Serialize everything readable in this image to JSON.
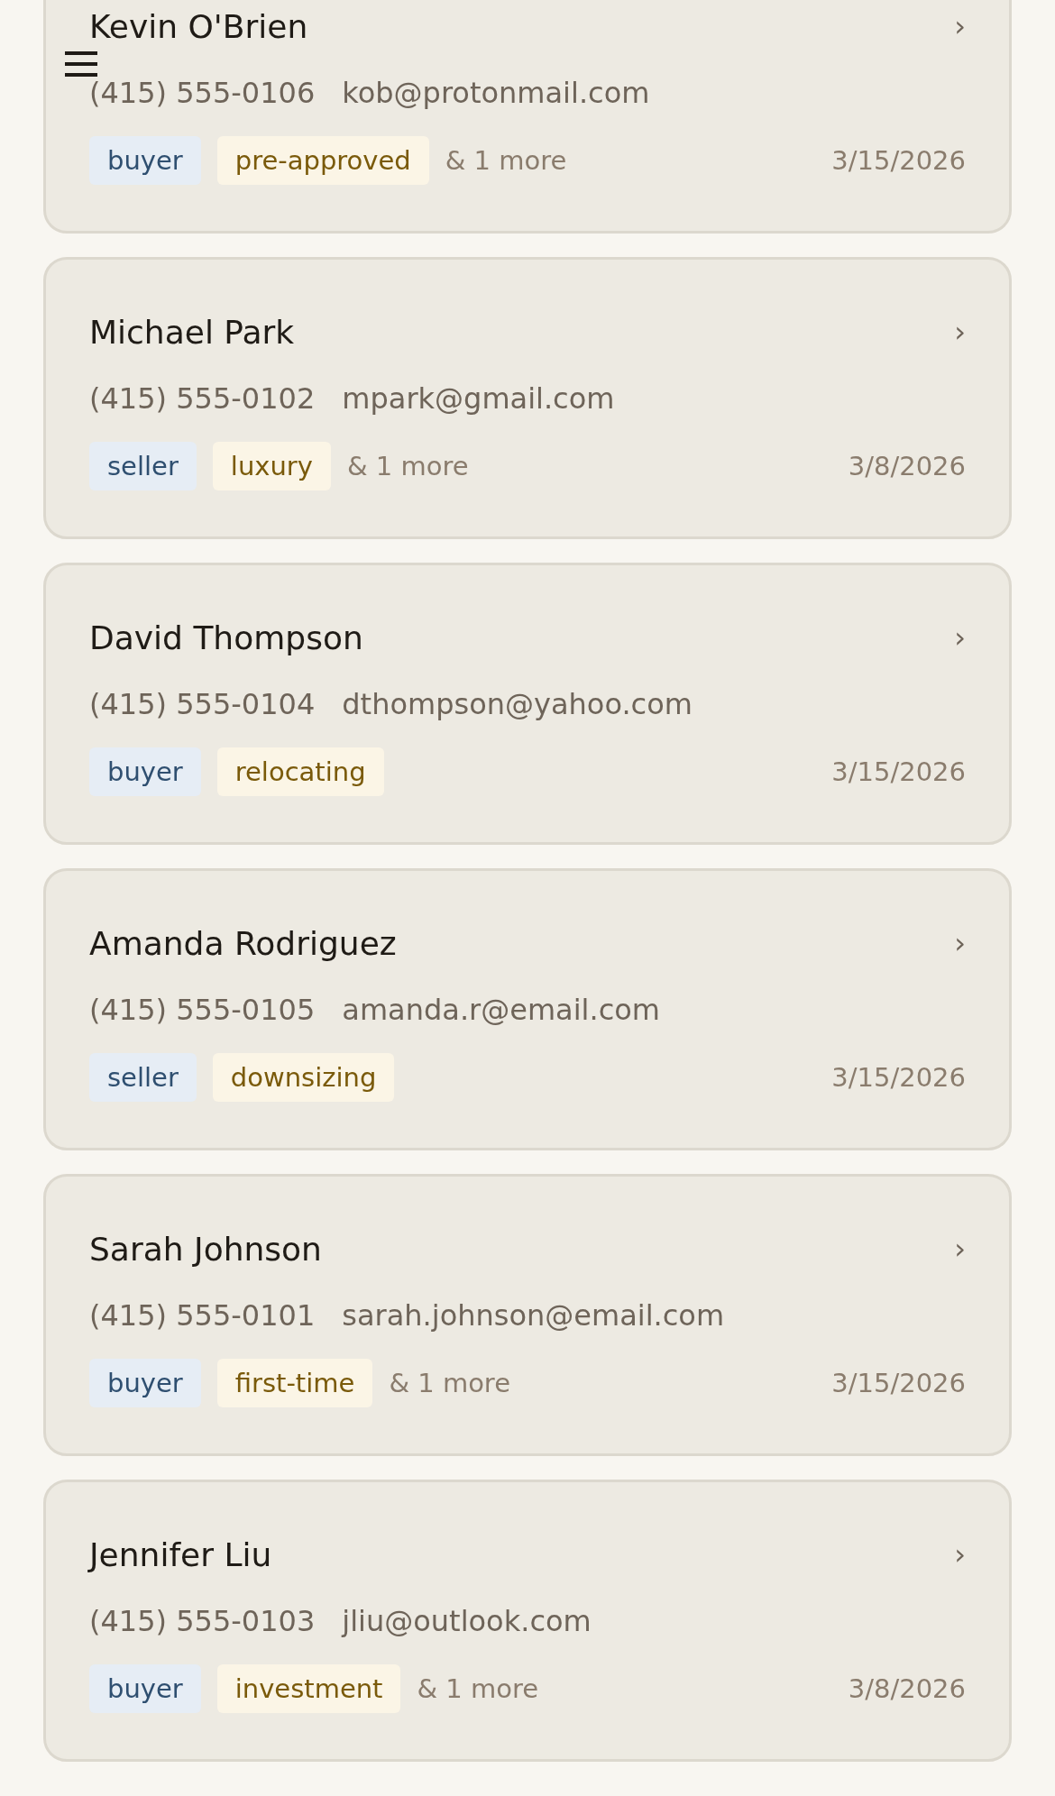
{
  "contacts": [
    {
      "name": "Kevin O'Brien",
      "phone": "(415) 555-0106",
      "email": "kob@protonmail.com",
      "tags": [
        {
          "label": "buyer",
          "kind": "role"
        },
        {
          "label": "pre-approved",
          "kind": "category"
        }
      ],
      "more": "& 1 more",
      "date": "3/15/2026",
      "chevron": "›"
    },
    {
      "name": "Michael Park",
      "phone": "(415) 555-0102",
      "email": "mpark@gmail.com",
      "tags": [
        {
          "label": "seller",
          "kind": "role"
        },
        {
          "label": "luxury",
          "kind": "category"
        }
      ],
      "more": "& 1 more",
      "date": "3/8/2026",
      "chevron": "›"
    },
    {
      "name": "David Thompson",
      "phone": "(415) 555-0104",
      "email": "dthompson@yahoo.com",
      "tags": [
        {
          "label": "buyer",
          "kind": "role"
        },
        {
          "label": "relocating",
          "kind": "category"
        }
      ],
      "date": "3/15/2026",
      "chevron": "›"
    },
    {
      "name": "Amanda Rodriguez",
      "phone": "(415) 555-0105",
      "email": "amanda.r@email.com",
      "tags": [
        {
          "label": "seller",
          "kind": "role"
        },
        {
          "label": "downsizing",
          "kind": "category"
        }
      ],
      "date": "3/15/2026",
      "chevron": "›"
    },
    {
      "name": "Sarah Johnson",
      "phone": "(415) 555-0101",
      "email": "sarah.johnson@email.com",
      "tags": [
        {
          "label": "buyer",
          "kind": "role"
        },
        {
          "label": "first-time",
          "kind": "category"
        }
      ],
      "more": "& 1 more",
      "date": "3/15/2026",
      "chevron": "›"
    },
    {
      "name": "Jennifer Liu",
      "phone": "(415) 555-0103",
      "email": "jliu@outlook.com",
      "tags": [
        {
          "label": "buyer",
          "kind": "role"
        },
        {
          "label": "investment",
          "kind": "category"
        }
      ],
      "more": "& 1 more",
      "date": "3/8/2026",
      "chevron": "›"
    }
  ]
}
